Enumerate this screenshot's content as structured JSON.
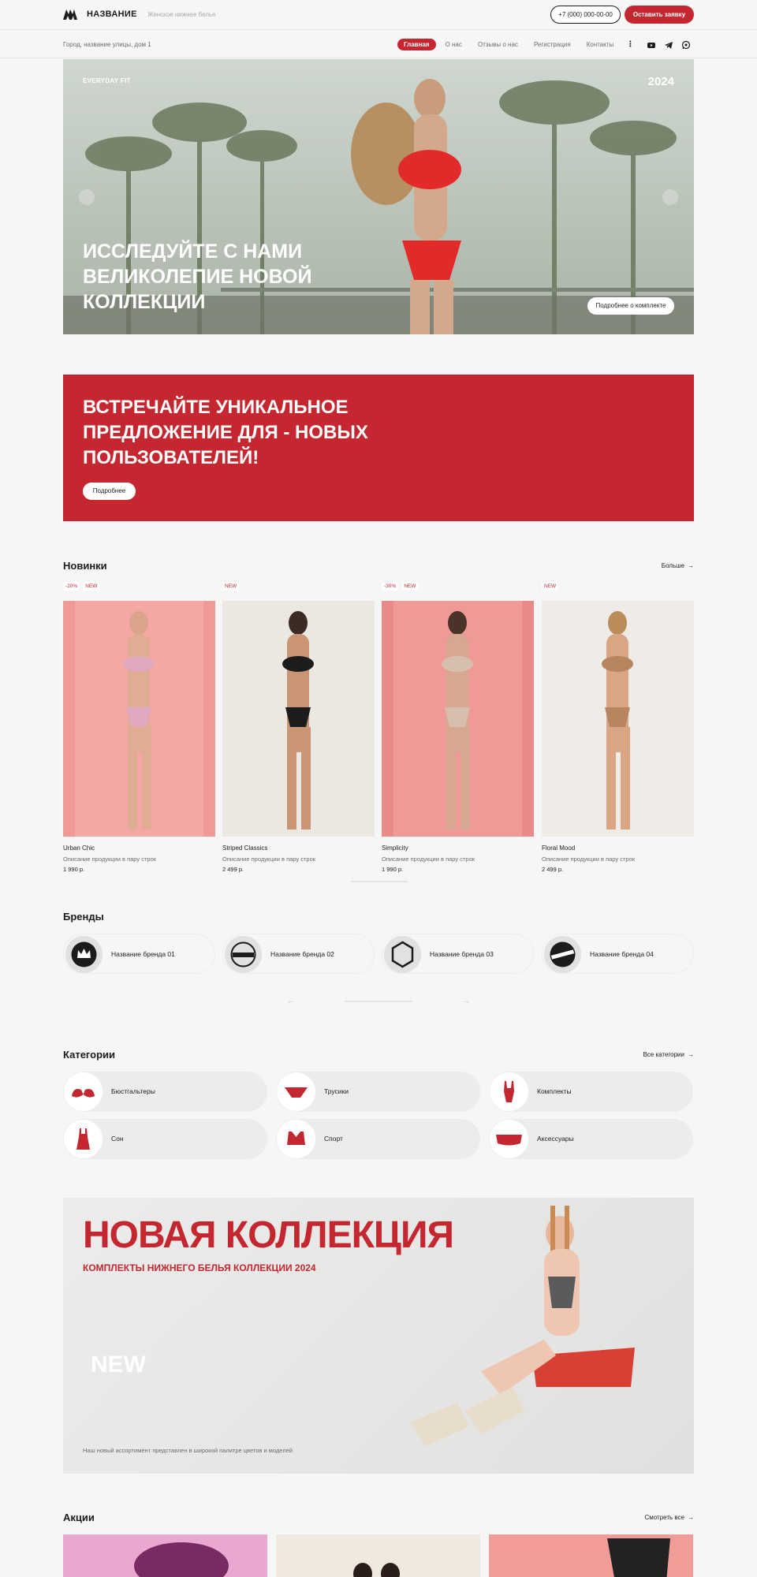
{
  "header": {
    "logo_text": "НАЗВАНИЕ",
    "logo_subtitle": "Женское нижнее белье",
    "phone": "+7 (000) 000-00-00",
    "cta": "Оставить заявку"
  },
  "subheader": {
    "address": "Город, название улицы, дом 1",
    "nav": [
      {
        "label": "Главная",
        "active": true
      },
      {
        "label": "О нас",
        "active": false
      },
      {
        "label": "Отзывы о нас",
        "active": false
      },
      {
        "label": "Регистрация",
        "active": false
      },
      {
        "label": "Контакты",
        "active": false
      }
    ],
    "social": [
      "youtube-icon",
      "telegram-icon",
      "whatsapp-icon"
    ]
  },
  "hero": {
    "tag": "EVERYDAY FIT",
    "year": "2024",
    "title": "ИССЛЕДУЙТЕ С НАМИ ВЕЛИКОЛЕПИЕ НОВОЙ КОЛЛЕКЦИИ",
    "button": "Подробнее о комплекте"
  },
  "promo": {
    "title": "ВСТРЕЧАЙТЕ УНИКАЛЬНОЕ ПРЕДЛОЖЕНИЕ ДЛЯ - НОВЫХ ПОЛЬЗОВАТЕЛЕЙ!",
    "button": "Подробнее"
  },
  "new_items": {
    "title": "Новинки",
    "more": "Больше",
    "products": [
      {
        "badges": [
          "-20%",
          "NEW"
        ],
        "name": "Urban Chic",
        "desc": "Описание продукции в пару строк",
        "price": "1 990 р."
      },
      {
        "badges": [
          "NEW"
        ],
        "name": "Striped Classics",
        "desc": "Описание продукции в пару строк",
        "price": "2 499 р."
      },
      {
        "badges": [
          "-30%",
          "NEW"
        ],
        "name": "Simplicity",
        "desc": "Описание продукции в пару строк",
        "price": "1 990 р."
      },
      {
        "badges": [
          "NEW"
        ],
        "name": "Floral Mood",
        "desc": "Описание продукции в пару строк",
        "price": "2 499 р."
      }
    ]
  },
  "brands": {
    "title": "Бренды",
    "items": [
      {
        "name": "Название бренда 01"
      },
      {
        "name": "Название бренда 02"
      },
      {
        "name": "Название бренда 03"
      },
      {
        "name": "Название бренда 04"
      }
    ]
  },
  "categories": {
    "title": "Категории",
    "all": "Все категории",
    "items": [
      {
        "name": "Бюстгальтеры",
        "icon": "bra-icon"
      },
      {
        "name": "Трусики",
        "icon": "panties-icon"
      },
      {
        "name": "Комплекты",
        "icon": "bodysuit-icon"
      },
      {
        "name": "Сон",
        "icon": "nightgown-icon"
      },
      {
        "name": "Спорт",
        "icon": "sport-top-icon"
      },
      {
        "name": "Аксессуары",
        "icon": "garter-icon"
      }
    ]
  },
  "collection": {
    "title": "НОВАЯ КОЛЛЕКЦИЯ",
    "subtitle": "КОМПЛЕКТЫ НИЖНЕГО БЕЛЬЯ КОЛЛЕКЦИИ 2024",
    "badge": "NEW",
    "note": "Наш новый ассортимент представлен в широкой палитре цветов и моделей"
  },
  "sales": {
    "title": "Акции",
    "all": "Смотреть все"
  },
  "colors": {
    "accent": "#c4272f",
    "background": "#f6f6f6"
  }
}
